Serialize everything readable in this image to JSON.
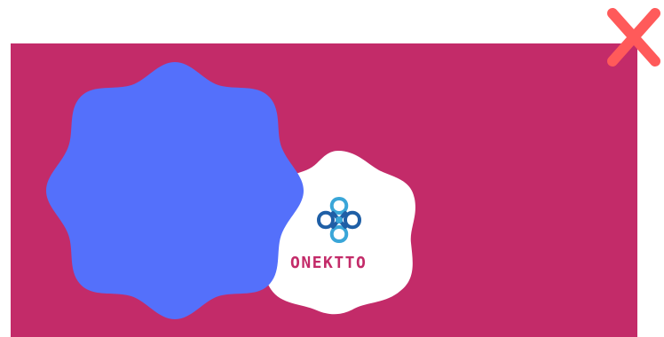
{
  "banner": {
    "background_color": "#c32b69"
  },
  "logo": {
    "wordmark": "ONEKTTO",
    "wordmark_color": "#c32b69",
    "badge_color": "#ffffff",
    "icon": "knot-icon",
    "icon_colors": [
      "#1f5fa6",
      "#3aa6d8"
    ]
  },
  "overlay": {
    "shape": "scalloped-blob",
    "color": "#5470fb"
  },
  "close": {
    "icon": "close-icon",
    "color": "#ff5a5a"
  }
}
